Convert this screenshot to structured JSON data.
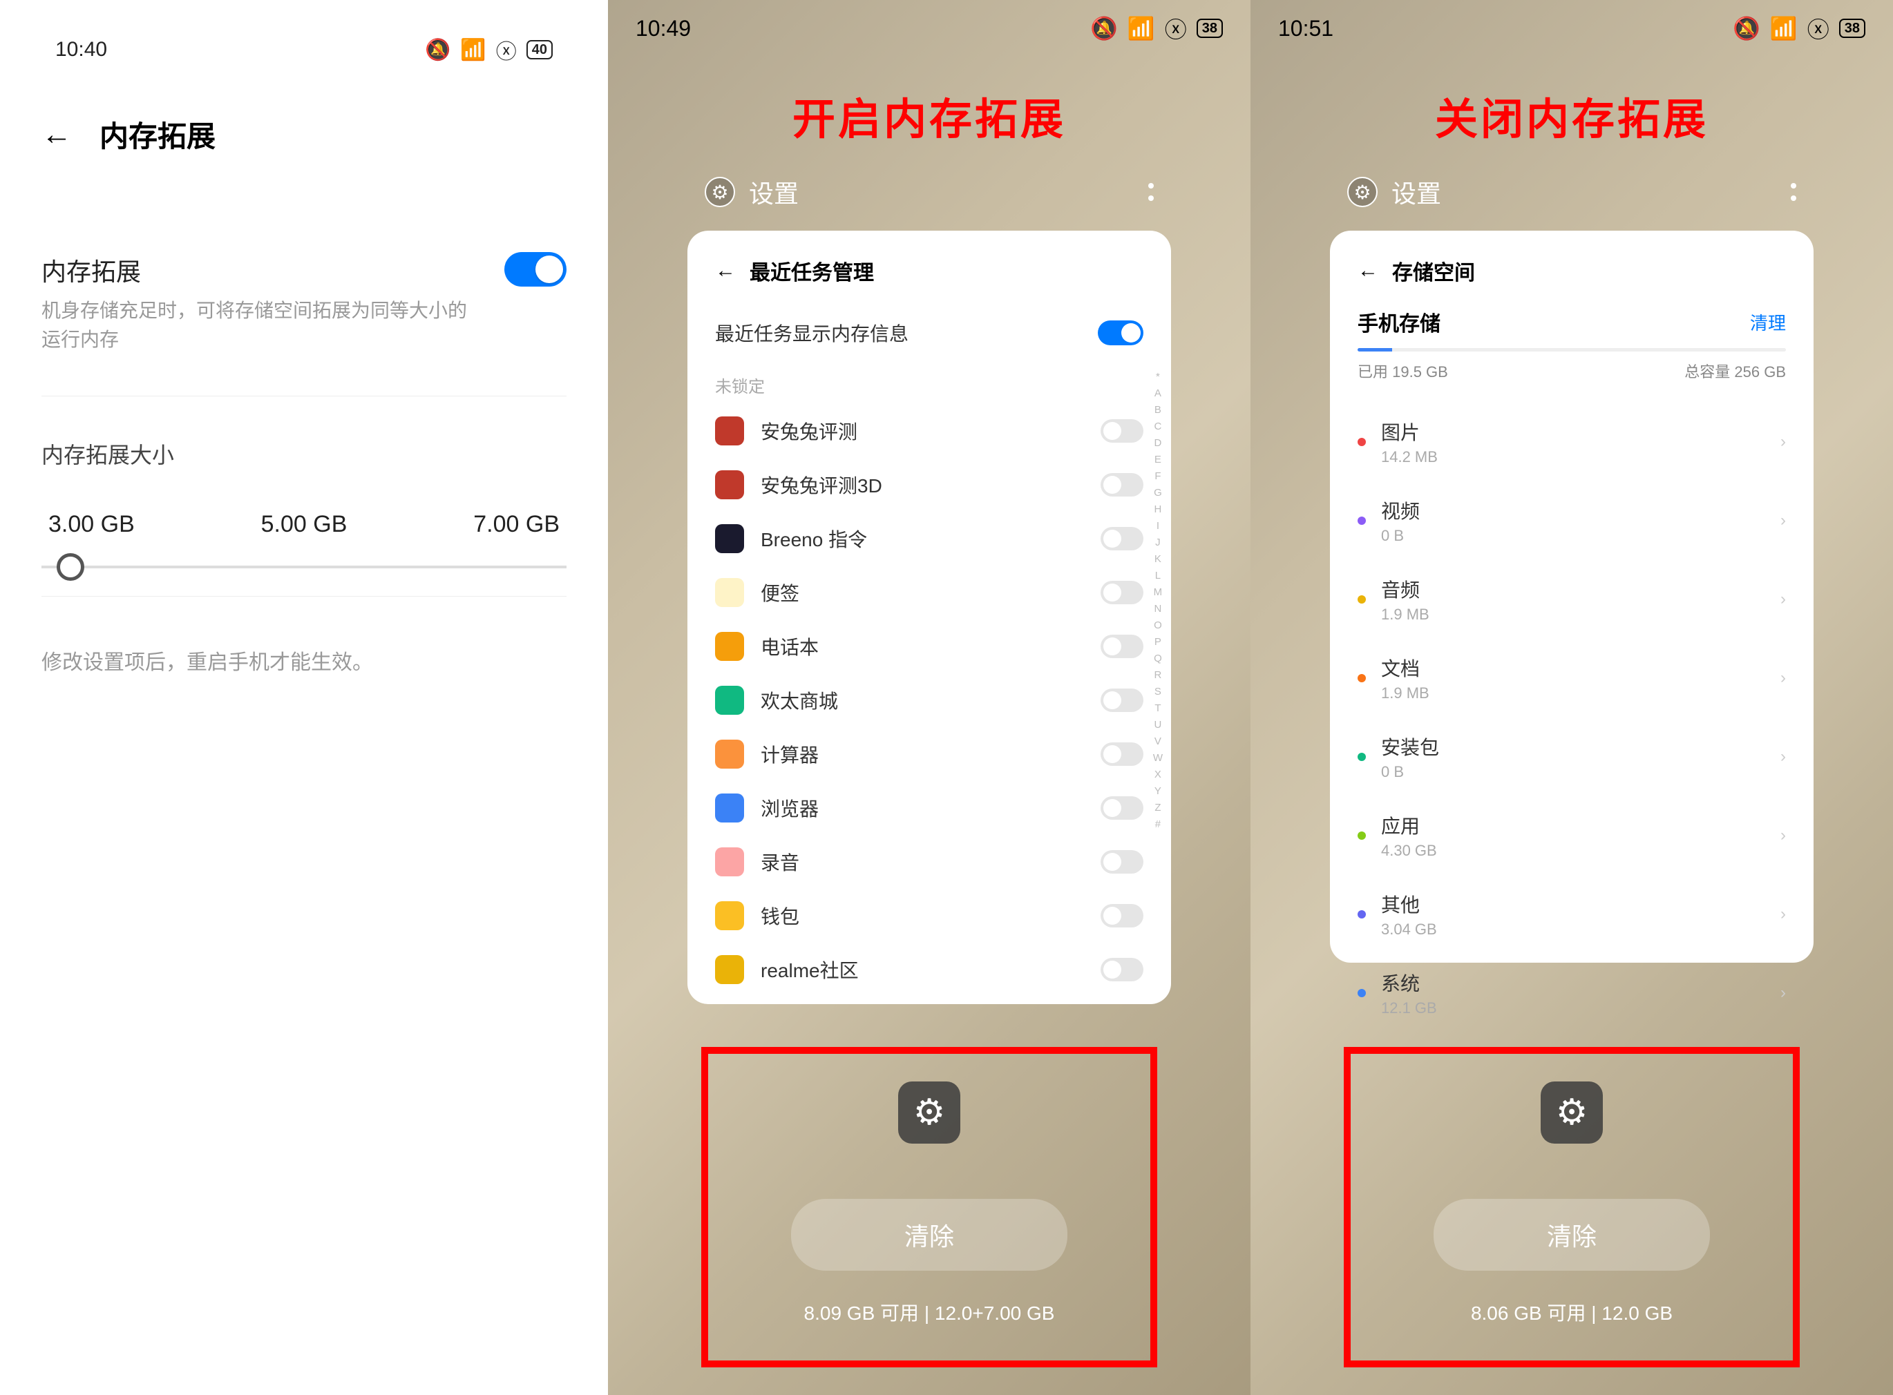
{
  "panel1": {
    "status_time": "10:40",
    "battery": "40",
    "page_title": "内存拓展",
    "toggle_label": "内存拓展",
    "toggle_desc": "机身存储充足时，可将存储空间拓展为同等大小的运行内存",
    "size_label": "内存拓展大小",
    "sizes": [
      "3.00 GB",
      "5.00 GB",
      "7.00 GB"
    ],
    "hint": "修改设置项后，重启手机才能生效。"
  },
  "panel2": {
    "status_time": "10:49",
    "battery": "38",
    "overlay_title": "开启内存拓展",
    "settings_label": "设置",
    "card_title": "最近任务管理",
    "show_mem_label": "最近任务显示内存信息",
    "unlocked_label": "未锁定",
    "apps": [
      {
        "name": "安兔兔评测",
        "color": "#c0392b"
      },
      {
        "name": "安兔兔评测3D",
        "color": "#c0392b"
      },
      {
        "name": "Breeno 指令",
        "color": "#1a1a2e"
      },
      {
        "name": "便签",
        "color": "#fef3c7"
      },
      {
        "name": "电话本",
        "color": "#f59e0b"
      },
      {
        "name": "欢太商城",
        "color": "#10b981"
      },
      {
        "name": "计算器",
        "color": "#fb923c"
      },
      {
        "name": "浏览器",
        "color": "#3b82f6"
      },
      {
        "name": "录音",
        "color": "#fca5a5"
      },
      {
        "name": "钱包",
        "color": "#fbbf24"
      },
      {
        "name": "realme社区",
        "color": "#eab308"
      }
    ],
    "alpha": "* A B C D E F G H I J K L M N O P Q R S T U V W X Y Z #",
    "clear_label": "清除",
    "mem_text": "8.09 GB 可用 | 12.0+7.00 GB"
  },
  "panel3": {
    "status_time": "10:51",
    "battery": "38",
    "overlay_title": "关闭内存拓展",
    "settings_label": "设置",
    "card_title": "存储空间",
    "storage_title": "手机存储",
    "cleanup": "清理",
    "used": "已用 19.5 GB",
    "total": "总容量 256 GB",
    "categories": [
      {
        "name": "图片",
        "size": "14.2 MB",
        "color": "#ef4444"
      },
      {
        "name": "视频",
        "size": "0 B",
        "color": "#8b5cf6"
      },
      {
        "name": "音频",
        "size": "1.9 MB",
        "color": "#eab308"
      },
      {
        "name": "文档",
        "size": "1.9 MB",
        "color": "#f97316"
      },
      {
        "name": "安装包",
        "size": "0 B",
        "color": "#10b981"
      },
      {
        "name": "应用",
        "size": "4.30  GB",
        "color": "#84cc16"
      },
      {
        "name": "其他",
        "size": "3.04 GB",
        "color": "#6366f1"
      },
      {
        "name": "系统",
        "size": "12.1 GB",
        "color": "#3b82f6"
      }
    ],
    "clear_label": "清除",
    "mem_text": "8.06 GB 可用 | 12.0 GB"
  }
}
